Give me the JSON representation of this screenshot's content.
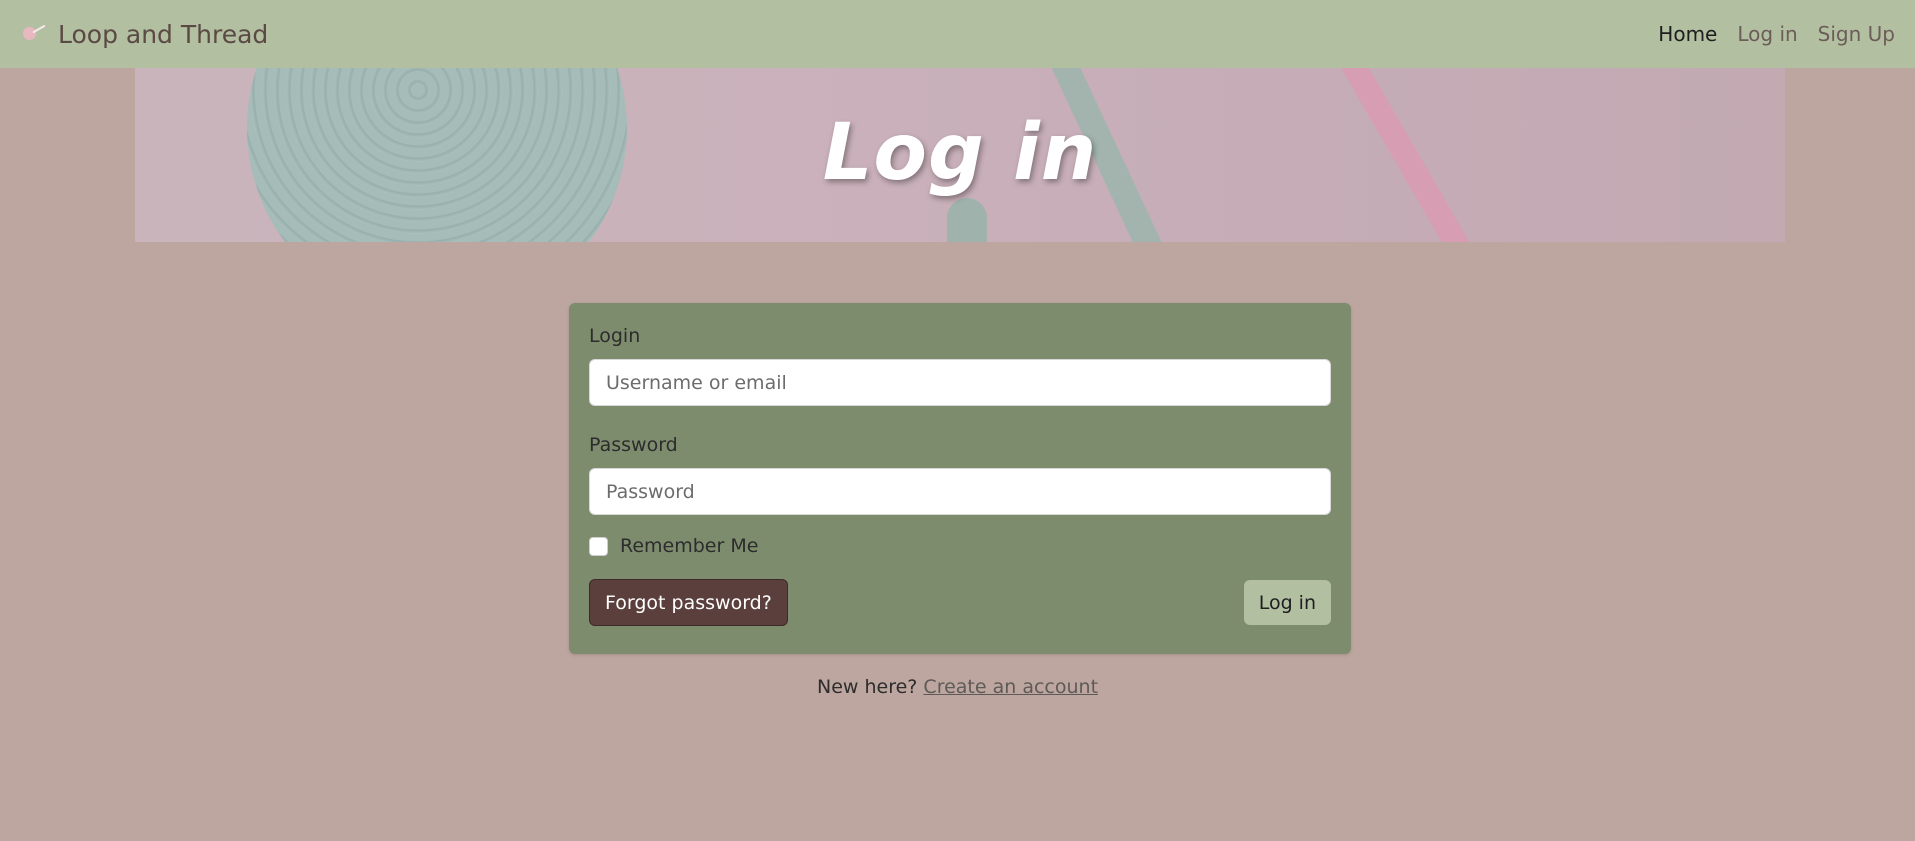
{
  "nav": {
    "brand": "Loop and Thread",
    "links": [
      {
        "label": "Home",
        "active": true
      },
      {
        "label": "Log in",
        "active": false
      },
      {
        "label": "Sign Up",
        "active": false
      }
    ]
  },
  "hero": {
    "title": "Log in"
  },
  "form": {
    "login_label": "Login",
    "login_placeholder": "Username or email",
    "password_label": "Password",
    "password_placeholder": "Password",
    "remember_label": "Remember Me",
    "remember_checked": false,
    "forgot_button": "Forgot password?",
    "submit_button": "Log in"
  },
  "signup": {
    "prompt": "New here?",
    "link": "Create an account"
  },
  "colors": {
    "background": "#bea6a0",
    "navbar": "#b3bfa1",
    "card": "#7e8c6e",
    "forgot_button": "#5a3f3c",
    "submit_button": "#b3bfa1"
  }
}
